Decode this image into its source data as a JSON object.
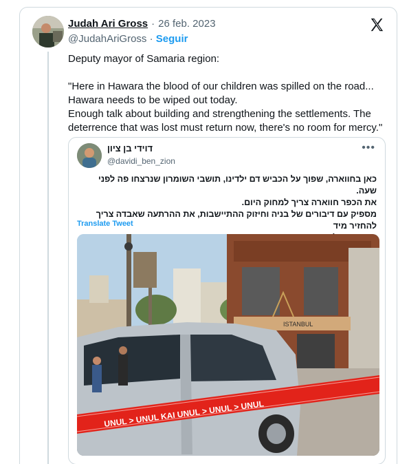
{
  "author": {
    "name": "Judah Ari Gross",
    "date_sep": "·",
    "date": "26 feb. 2023",
    "handle": "@JudahAriGross",
    "follow_sep": "·",
    "follow_label": "Seguir"
  },
  "tweet": {
    "text": "Deputy mayor of Samaria region:\n\n\"Here in Hawara the blood of our children was spilled on the road...\nHawara needs to be wiped out today.\nEnough talk about building and strengthening the settlements. The deterrence that was lost must return now, there's no room for mercy.\""
  },
  "quote": {
    "name": "דוידי בן ציון",
    "handle": "@davidi_ben_zion",
    "text": "כאן בחווארה, שפוך על הכביש דם ילדינו, תושבי השומרון שנרצחו פה לפני שעה.\nאת הכפר חווארה צריך למחוק היום.\nמספיק עם דיבורים של בניה וחיזוק ההתיישבות, את ההרתעה שאבדה צריך להחזיר מיד\nואין מקום לרחמים.",
    "translate_label": "Translate Tweet",
    "more_icon": "ellipsis-icon",
    "photo": {
      "shop_sign": "ISTANBUL",
      "tape_text": "UNUL > UNUL KAI UNUL"
    }
  },
  "icons": {
    "platform": "x-logo-icon"
  },
  "colors": {
    "link": "#1d9bf0",
    "secondary_text": "#536471",
    "border": "#cfd9de",
    "police_tape": "#e2231a"
  }
}
